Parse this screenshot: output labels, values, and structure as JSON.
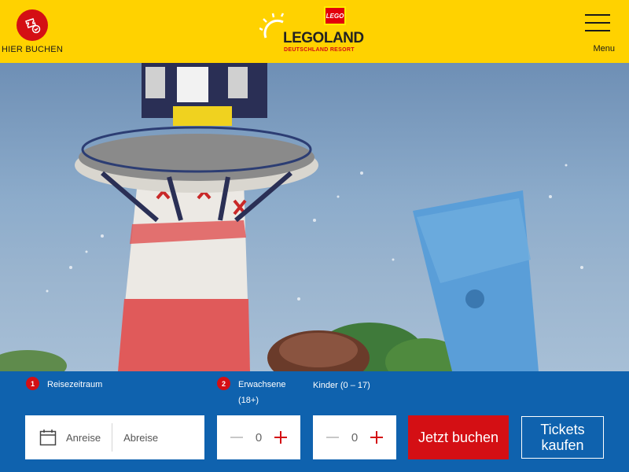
{
  "header": {
    "book_label": "HIER BUCHEN",
    "logo": {
      "brand_box": "LEGO",
      "name": "LEGOLAND",
      "subtitle": "DEUTSCHLAND RESORT"
    },
    "menu_label": "Menu"
  },
  "hero": {
    "description": "lighthouse-water-ride-photo"
  },
  "booking": {
    "step1": {
      "number": "1",
      "label": "Reisezeitraum"
    },
    "step2": {
      "number": "2",
      "label": "Erwachsene (18+)"
    },
    "kids_label": "Kinder (0 – 17)",
    "arrival_label": "Anreise",
    "departure_label": "Abreise",
    "adults_value": "0",
    "kids_value": "0",
    "book_button": "Jetzt buchen",
    "tickets_button": "Tickets kaufen"
  },
  "icons": [
    "ticket-icon",
    "sun-icon",
    "hamburger-icon",
    "calendar-icon",
    "minus-icon",
    "plus-icon"
  ],
  "colors": {
    "header_yellow": "#ffd200",
    "brand_red": "#d40f14",
    "booking_blue": "#0f62ae"
  }
}
